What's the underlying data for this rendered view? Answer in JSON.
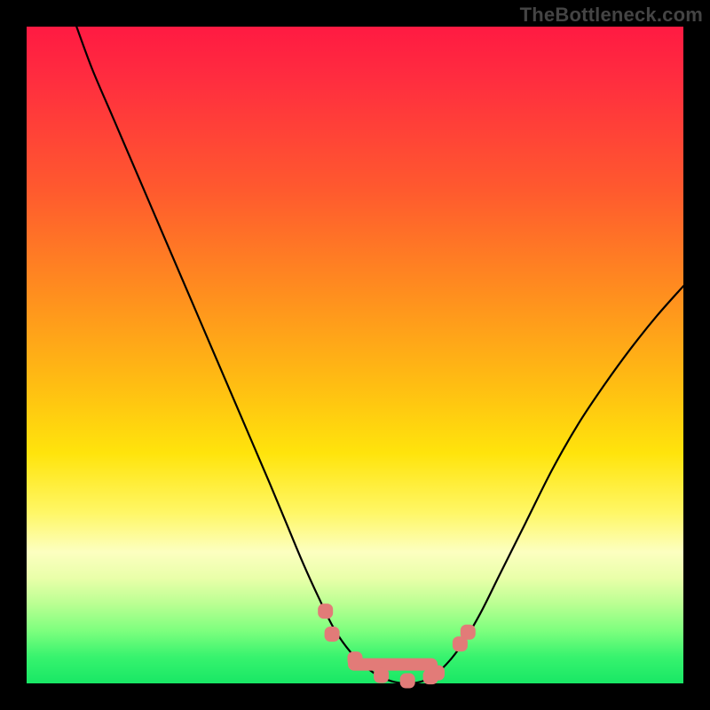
{
  "watermark": "TheBottleneck.com",
  "colors": {
    "frame": "#000000",
    "curve": "#000000",
    "marker_fill": "#e27b78",
    "marker_stroke": "#b85a57",
    "gradient_top": "#ff1a42",
    "gradient_bottom": "#18e765"
  },
  "chart_data": {
    "type": "line",
    "title": "",
    "xlabel": "",
    "ylabel": "",
    "xlim": [
      0,
      1
    ],
    "ylim": [
      0,
      1
    ],
    "grid": false,
    "legend": false,
    "annotations": [
      "TheBottleneck.com"
    ],
    "series": [
      {
        "name": "curve",
        "x": [
          0.076,
          0.1,
          0.13,
          0.16,
          0.19,
          0.22,
          0.25,
          0.28,
          0.31,
          0.34,
          0.37,
          0.395,
          0.42,
          0.445,
          0.47,
          0.5,
          0.53,
          0.555,
          0.58,
          0.605,
          0.63,
          0.66,
          0.69,
          0.72,
          0.76,
          0.8,
          0.84,
          0.88,
          0.92,
          0.96,
          1.0
        ],
        "y": [
          1.0,
          0.935,
          0.865,
          0.795,
          0.725,
          0.655,
          0.585,
          0.515,
          0.445,
          0.375,
          0.305,
          0.245,
          0.185,
          0.13,
          0.08,
          0.04,
          0.015,
          0.0035,
          0.0,
          0.004,
          0.02,
          0.055,
          0.105,
          0.165,
          0.245,
          0.325,
          0.395,
          0.455,
          0.51,
          0.56,
          0.605
        ]
      }
    ],
    "markers": {
      "name": "highlighted-points",
      "x": [
        0.455,
        0.465,
        0.5,
        0.54,
        0.58,
        0.615,
        0.625,
        0.66,
        0.672
      ],
      "y": [
        0.11,
        0.075,
        0.037,
        0.012,
        0.004,
        0.01,
        0.016,
        0.06,
        0.078
      ]
    }
  }
}
